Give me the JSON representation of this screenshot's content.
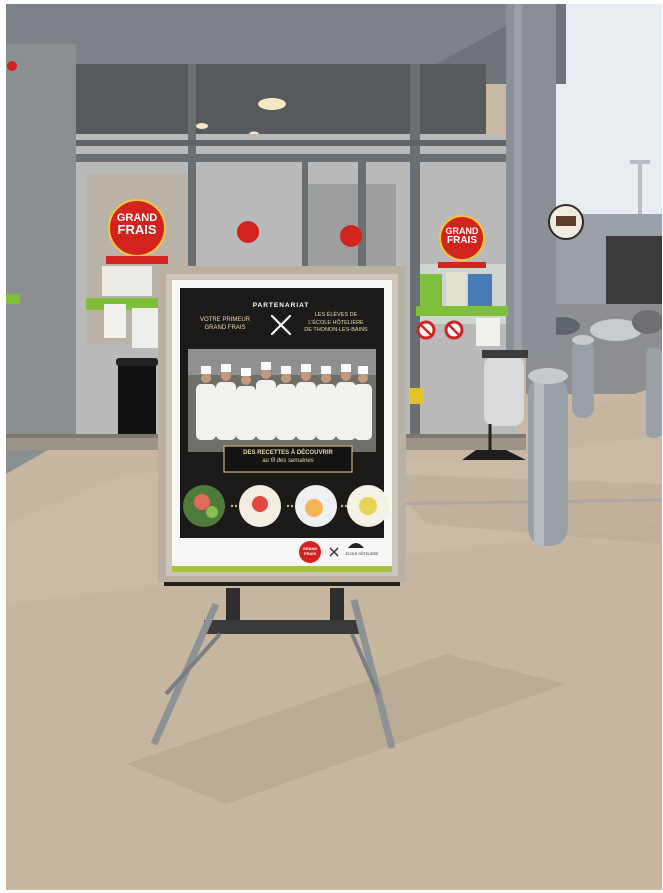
{
  "store": {
    "sign_line1": "GRAND",
    "sign_line2": "FRAIS"
  },
  "poster": {
    "partnership": "PARTENARIAT",
    "left_line1": "VOTRE PRIMEUR",
    "left_line2": "GRAND FRAIS",
    "right_line1": "LES ÉLÈVES DE",
    "right_line2": "L'ÉCOLE HÔTELIÈRE",
    "right_line3": "DE THONON-LES-BAINS",
    "banner_line1": "DES RECETTES À DÉCOUVRIR",
    "banner_line2": "au fil des semaines",
    "footer_logo_line1": "GRAND",
    "footer_logo_line2": "FRAIS",
    "school_logo_text": "ÉCOLE HÔTELIÈRE"
  },
  "colors": {
    "sign_red": "#d2231f",
    "poster_black": "#1c1a18",
    "accent_green": "#7fbf3a",
    "sky": "#e9eef3",
    "pavement": "#c7b7a0"
  }
}
